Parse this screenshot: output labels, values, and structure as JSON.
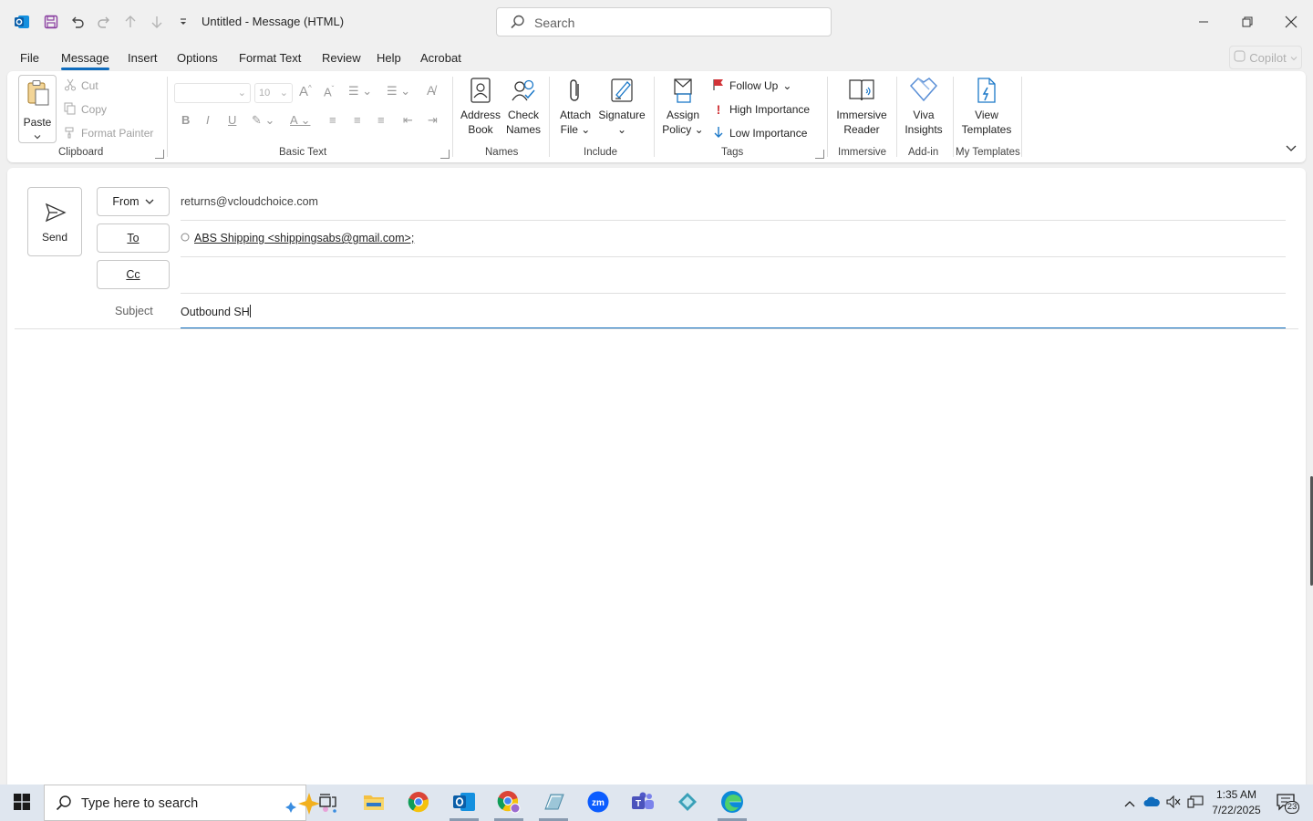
{
  "titlebar": {
    "title": "Untitled  -  Message (HTML)",
    "search_placeholder": "Search"
  },
  "menu": {
    "tabs": [
      "File",
      "Message",
      "Insert",
      "Options",
      "Format Text",
      "Review",
      "Help",
      "Acrobat"
    ],
    "active": "Message",
    "copilot": "Copilot"
  },
  "ribbon": {
    "clipboard": {
      "label": "Clipboard",
      "paste": "Paste",
      "cut": "Cut",
      "copy": "Copy",
      "format_painter": "Format Painter"
    },
    "basic_text": {
      "label": "Basic Text",
      "font_size": "10"
    },
    "names": {
      "label": "Names",
      "address_book": [
        "Address",
        "Book"
      ],
      "check_names": [
        "Check",
        "Names"
      ]
    },
    "include": {
      "label": "Include",
      "attach_file": [
        "Attach",
        "File"
      ],
      "signature": "Signature"
    },
    "tags": {
      "label": "Tags",
      "assign_policy": [
        "Assign",
        "Policy"
      ],
      "follow_up": "Follow Up",
      "high_importance": "High Importance",
      "low_importance": "Low Importance"
    },
    "immersive": {
      "label": "Immersive",
      "immersive_reader": [
        "Immersive",
        "Reader"
      ]
    },
    "addin": {
      "label": "Add-in",
      "viva_insights": [
        "Viva",
        "Insights"
      ]
    },
    "templates": {
      "label": "My Templates",
      "view_templates": [
        "View",
        "Templates"
      ]
    }
  },
  "compose": {
    "send": "Send",
    "from_label": "From",
    "from_value": "returns@vcloudchoice.com",
    "to_label": "To",
    "to_value": "ABS Shipping <shippingsabs@gmail.com>;",
    "cc_label": "Cc",
    "cc_value": "",
    "subject_label": "Subject",
    "subject_value": "Outbound SH"
  },
  "taskbar": {
    "search_placeholder": "Type here to search",
    "time": "1:35 AM",
    "date": "7/22/2025",
    "notification_count": "23"
  },
  "colors": {
    "accent": "#0f6cbd",
    "outlook_blue": "#0f6cbd",
    "flag_red": "#d13438"
  }
}
